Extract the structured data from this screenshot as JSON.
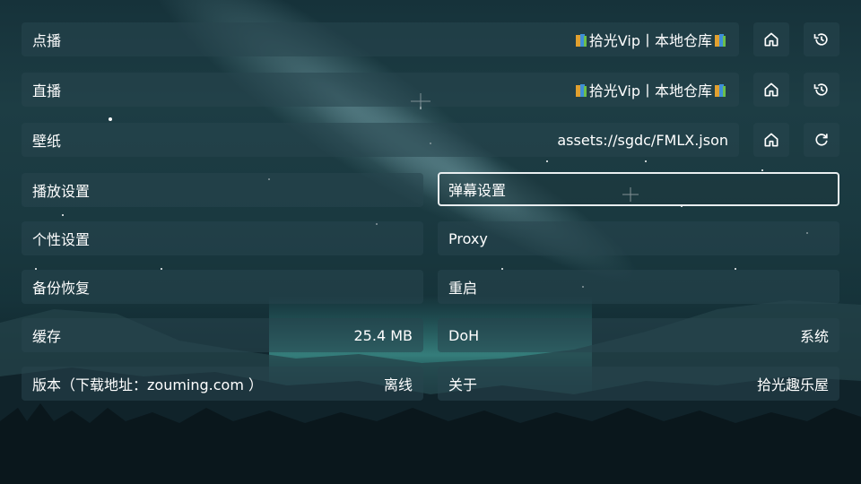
{
  "rows": {
    "vod": {
      "label": "点播",
      "value_text": "拾光Vip丨本地仓库",
      "home_icon": "home-icon",
      "history_icon": "history-icon"
    },
    "live": {
      "label": "直播",
      "value_text": "拾光Vip丨本地仓库",
      "home_icon": "home-icon",
      "history_icon": "history-icon"
    },
    "wallpaper": {
      "label": "壁纸",
      "value": "assets://sgdc/FMLX.json",
      "home_icon": "home-icon",
      "refresh_icon": "refresh-icon"
    }
  },
  "settings": {
    "playback": {
      "label": "播放设置"
    },
    "danmaku": {
      "label": "弹幕设置"
    },
    "personal": {
      "label": "个性设置"
    },
    "proxy": {
      "label": "Proxy"
    },
    "backup": {
      "label": "备份恢复"
    },
    "restart": {
      "label": "重启"
    },
    "cache": {
      "label": "缓存",
      "value": "25.4 MB"
    },
    "doh": {
      "label": "DoH",
      "value": "系统"
    },
    "version": {
      "label": "版本（下载地址：zouming.com ）",
      "value": "离线"
    },
    "about": {
      "label": "关于",
      "value": "拾光趣乐屋"
    }
  },
  "colors": {
    "focus_border": "#e9eef0",
    "row_bg": "rgba(40,70,78,0.55)"
  }
}
